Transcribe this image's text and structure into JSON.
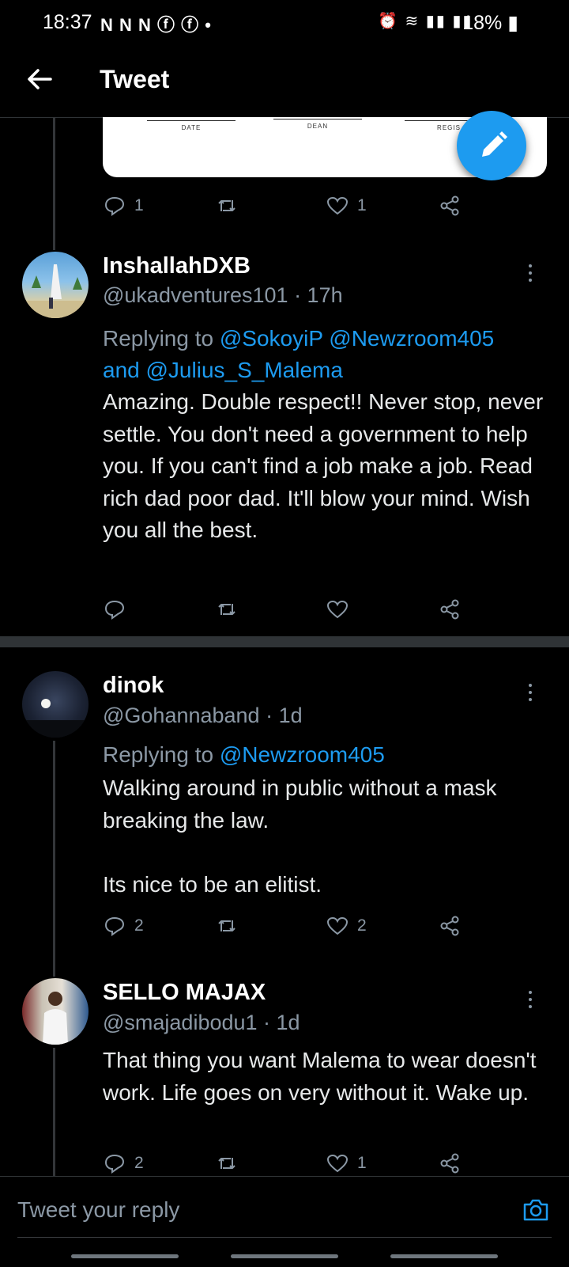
{
  "status_bar": {
    "time": "18:37",
    "notification_icons": "N N N ⓕ ⓕ •",
    "battery": "18%"
  },
  "header": {
    "title": "Tweet"
  },
  "media_card": {
    "sig_labels": [
      "DATE",
      "DEAN",
      "REGIS"
    ]
  },
  "top_actions": {
    "reply_count": "1",
    "like_count": "1"
  },
  "tweets": [
    {
      "name": "InshallahDXB",
      "handle": "@ukadventures101 · 17h",
      "replying_prefix": "Replying to ",
      "replying_line1_links": "@SokoyiP @Newzroom405",
      "replying_and": "and ",
      "replying_line2_link": "@Julius_S_Malema",
      "text": "Amazing. Double respect!! Never stop, never settle. You don't need a government to help you. If you can't find a job make a job. Read rich dad poor dad. It'll blow your mind. Wish you all the best.",
      "reply_count": "",
      "like_count": ""
    },
    {
      "name": "dinok",
      "handle": "@Gohannaband · 1d",
      "replying_prefix": "Replying to ",
      "replying_link": "@Newzroom405",
      "text": "Walking around in public without a mask breaking the law.\n\nIts nice to be an elitist.",
      "reply_count": "2",
      "like_count": "2"
    },
    {
      "name": "SELLO MAJAX",
      "handle": "@smajadibodu1 · 1d",
      "text": "That thing you want Malema to wear doesn't  work. Life goes on very without it. Wake up.",
      "reply_count": "2",
      "like_count": "1"
    }
  ],
  "compose": {
    "placeholder": "Tweet your reply"
  },
  "colors": {
    "accent": "#1d9bf0",
    "background": "#000000",
    "secondary_text": "#8b98a5",
    "divider": "#2f3336"
  },
  "icons": [
    "back-arrow-icon",
    "compose-icon",
    "reply-icon",
    "retweet-icon",
    "like-icon",
    "share-icon",
    "more-icon",
    "camera-icon"
  ]
}
